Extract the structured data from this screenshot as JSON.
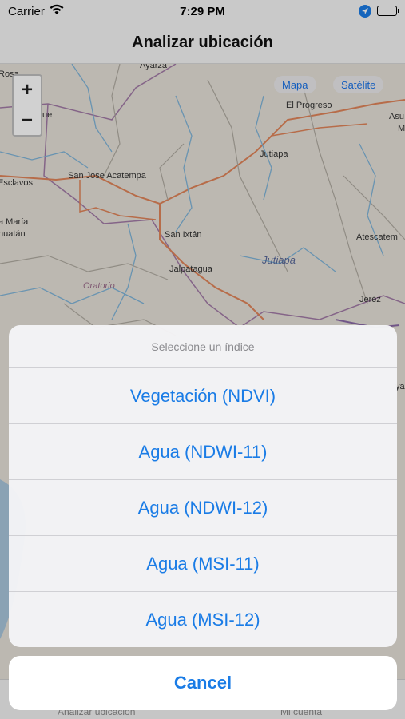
{
  "status_bar": {
    "carrier": "Carrier",
    "time": "7:29 PM",
    "icons": [
      "wifi-icon",
      "location-arrow-icon",
      "battery-icon"
    ]
  },
  "nav": {
    "title": "Analizar ubicación"
  },
  "map": {
    "zoom_in": "+",
    "zoom_out": "−",
    "map_type_buttons": [
      "Mapa",
      "Satélite"
    ],
    "place_labels": [
      "Rosa",
      "Ayarza",
      "El Progreso",
      "Asu",
      "M",
      "Jutiapa",
      "San Jose Acatempa",
      "Esclavos",
      "San Ixtán",
      "a María",
      "huatán",
      "Atescatem",
      "Jutiapa",
      "Jalpatagua",
      "Oratorio",
      "Jeréz",
      "ya",
      "ue"
    ]
  },
  "action_sheet": {
    "title": "Seleccione un índice",
    "options": [
      "Vegetación (NDVI)",
      "Agua (NDWI-11)",
      "Agua (NDWI-12)",
      "Agua (MSI-11)",
      "Agua (MSI-12)"
    ],
    "cancel": "Cancel"
  },
  "tab_bar": {
    "tabs": [
      "Analizar ubicación",
      "Mi cuenta"
    ]
  },
  "colors": {
    "accent": "#1a7ce6",
    "map_bg": "#e6e1d8",
    "road": "#e0845a",
    "river": "#7fb4d8",
    "border": "#a27aa6"
  }
}
